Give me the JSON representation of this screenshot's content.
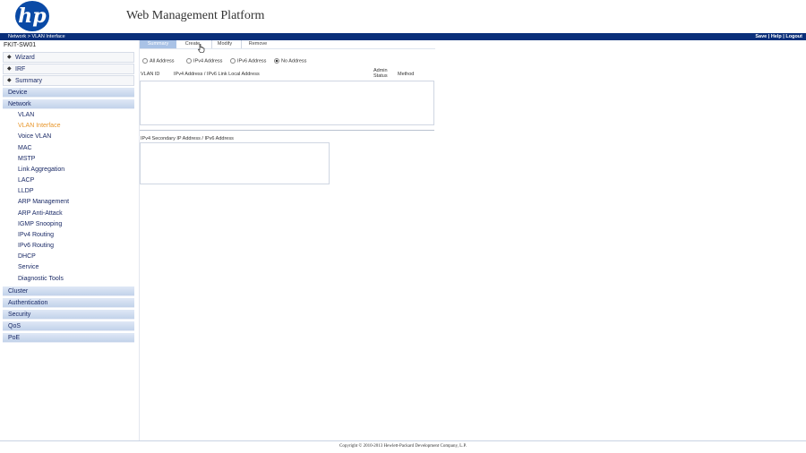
{
  "header": {
    "logo_text": "hp",
    "title": "Web Management Platform"
  },
  "navbar": {
    "breadcrumb": "Network > VLAN Interface",
    "links": [
      "Save",
      "Help",
      "Logout"
    ],
    "separator": "|"
  },
  "sidebar": {
    "device_name": "FKIT-SW01",
    "top_items": [
      "Wizard",
      "IRF",
      "Summary"
    ],
    "categories_before": [
      "Device",
      "Network"
    ],
    "network_items": [
      "VLAN",
      "VLAN Interface",
      "Voice VLAN",
      "MAC",
      "MSTP",
      "Link Aggregation",
      "LACP",
      "LLDP",
      "ARP Management",
      "ARP Anti-Attack",
      "IGMP Snooping",
      "IPv4 Routing",
      "IPv6 Routing",
      "DHCP",
      "Service",
      "Diagnostic Tools"
    ],
    "active_item": "VLAN Interface",
    "categories_after": [
      "Cluster",
      "Authentication",
      "Security",
      "QoS",
      "PoE"
    ]
  },
  "tabs": [
    "Summary",
    "Create",
    "Modify",
    "Remove"
  ],
  "filter": {
    "options": [
      "All Address",
      "IPv4 Address",
      "IPv6 Address",
      "No Address"
    ],
    "selected": "No Address"
  },
  "table1": {
    "columns": [
      "VLAN ID",
      "IPv4 Address / IPv6 Link Local Address",
      "Admin\nStatus",
      "Method"
    ]
  },
  "table2": {
    "label": "IPv4 Secondary IP Address / IPv6 Address"
  },
  "footer": {
    "copyright": "Copyright © 2010-2013 Hewlett-Packard Development Company, L.P."
  },
  "colors": {
    "navbar": "#0a2f7a",
    "logo": "#0a4aa6",
    "active_tab": "#a9c2e6",
    "active_item": "#e8962a",
    "link": "#1a2a66"
  }
}
